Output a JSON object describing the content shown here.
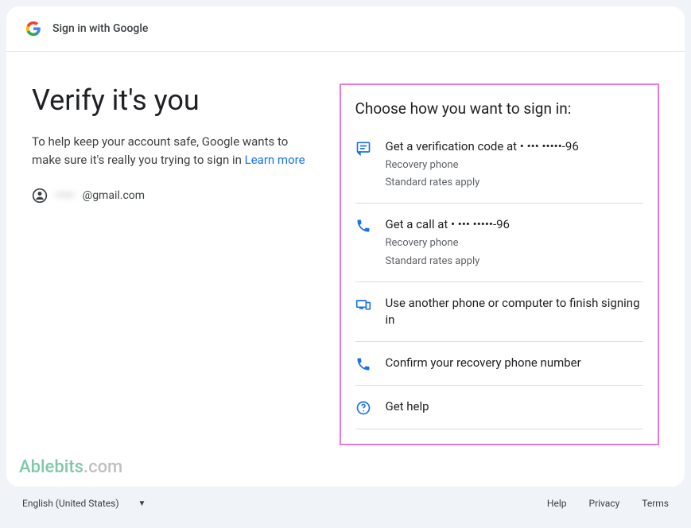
{
  "header": {
    "title": "Sign in with Google"
  },
  "main": {
    "title": "Verify it's you",
    "description": "To help keep your account safe, Google wants to make sure it's really you trying to sign in ",
    "learn_more": "Learn more",
    "account_masked": "•••••",
    "account_domain": "@gmail.com"
  },
  "choose": {
    "title": "Choose how you want to sign in:",
    "options": [
      {
        "title": "Get a verification code at • ••• •••••-96",
        "sub1": "Recovery phone",
        "sub2": "Standard rates apply"
      },
      {
        "title": "Get a call at • ••• •••••-96",
        "sub1": "Recovery phone",
        "sub2": "Standard rates apply"
      },
      {
        "title": "Use another phone or computer to finish signing in"
      },
      {
        "title": "Confirm your recovery phone number"
      },
      {
        "title": "Get help"
      }
    ]
  },
  "watermark": {
    "brand": "Ablebits",
    "suffix": ".com"
  },
  "footer": {
    "language": "English (United States)",
    "links": {
      "help": "Help",
      "privacy": "Privacy",
      "terms": "Terms"
    }
  }
}
